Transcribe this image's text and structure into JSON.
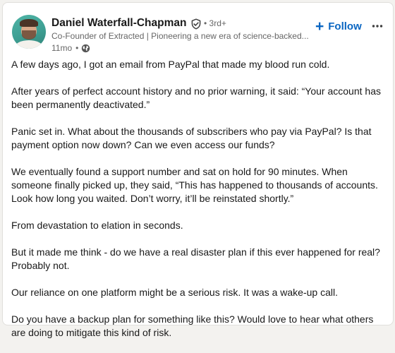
{
  "author": {
    "name": "Daniel Waterfall-Chapman",
    "degree": "• 3rd+",
    "headline": "Co-Founder of Extracted | Pioneering a new era of science-backed...",
    "timestamp": "11mo",
    "visibility_icon": "globe-icon",
    "verified_icon": "verified-shield-icon"
  },
  "actions": {
    "follow_label": "Follow",
    "follow_icon": "+",
    "more_icon": "more-dots-icon"
  },
  "colors": {
    "accent": "#0a66c2",
    "text": "#191919",
    "secondary_text": "#666666"
  },
  "post": {
    "paragraphs": [
      "A few days ago, I got an email from PayPal that made my blood run cold.",
      "After years of perfect account history and no prior warning, it said: “Your account has been permanently deactivated.”",
      "Panic set in. What about the thousands of subscribers who pay via PayPal? Is that payment option now down? Can we even access our funds?",
      "We eventually found a support number and sat on hold for 90 minutes. When someone finally picked up, they said, “This has happened to thousands of accounts. Look how long you waited. Don’t worry, it’ll be reinstated shortly.”",
      "From devastation to elation in seconds.",
      "But it made me think - do we have a real disaster plan if this ever happened for real? Probably not.",
      "Our reliance on one platform might be a serious risk. It was a wake-up call.",
      "Do you have a backup plan for something like this? Would love to hear what others are doing to mitigate this kind of risk."
    ]
  }
}
